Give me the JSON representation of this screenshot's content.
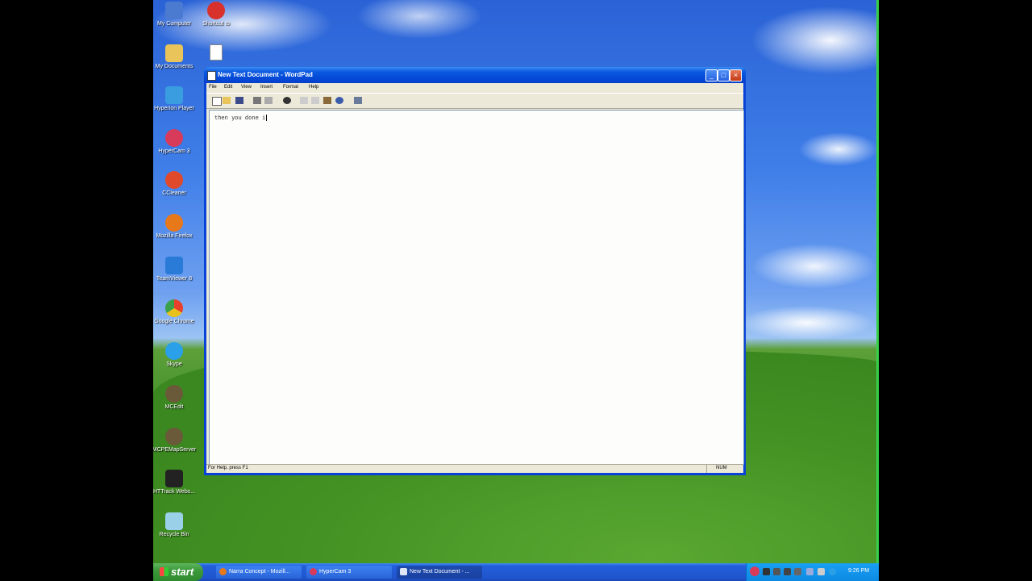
{
  "desktop": {
    "icons": [
      {
        "label": "My Computer",
        "icon": "my-computer-icon",
        "color": "#4a7bd0"
      },
      {
        "label": "Shortcut to",
        "icon": "shortcut-icon",
        "color": "#d8302a"
      },
      {
        "label": "My Documents",
        "icon": "my-documents-icon",
        "color": "#e8c45a"
      },
      {
        "label": "",
        "icon": "text-file-icon",
        "color": "#ffffff"
      },
      {
        "label": "Hyperion Player",
        "icon": "player-icon",
        "color": "#3a9de0"
      },
      {
        "label": "HyperCam 3",
        "icon": "hypercam-icon",
        "color": "#d83a5a"
      },
      {
        "label": "CCleaner",
        "icon": "ccleaner-icon",
        "color": "#e04a2a"
      },
      {
        "label": "Mozilla Firefox",
        "icon": "firefox-icon",
        "color": "#e8791a"
      },
      {
        "label": "TeamViewer 8",
        "icon": "teamviewer-icon",
        "color": "#2a7ad8"
      },
      {
        "label": "Google Chrome",
        "icon": "chrome-icon",
        "color": "#e8c21a"
      },
      {
        "label": "Skype",
        "icon": "skype-icon",
        "color": "#2aa0e8"
      },
      {
        "label": "MCEdit",
        "icon": "mcedit-icon",
        "color": "#6a5a3a"
      },
      {
        "label": "MCPEMapServer",
        "icon": "mcpe-icon",
        "color": "#6a5a3a"
      },
      {
        "label": "HTTrack Webs...",
        "icon": "floppy-icon",
        "color": "#222222"
      },
      {
        "label": "Recycle Bin",
        "icon": "recycle-bin-icon",
        "color": "#9ad0e8"
      }
    ]
  },
  "window": {
    "title": "New Text Document - WordPad",
    "menus": [
      "File",
      "Edit",
      "View",
      "Insert",
      "Format",
      "Help"
    ],
    "document_text": "then you done i",
    "status_left": "For Help, press F1",
    "status_num": "NUM"
  },
  "taskbar": {
    "start_label": "start",
    "tasks": [
      {
        "label": "Narra Concept - Mozill...",
        "color": "#e8791a"
      },
      {
        "label": "HyperCam 3",
        "color": "#d83a5a"
      },
      {
        "label": "New Text Document - ...",
        "color": "#4a7bd0"
      }
    ],
    "clock": "9:26 PM"
  }
}
